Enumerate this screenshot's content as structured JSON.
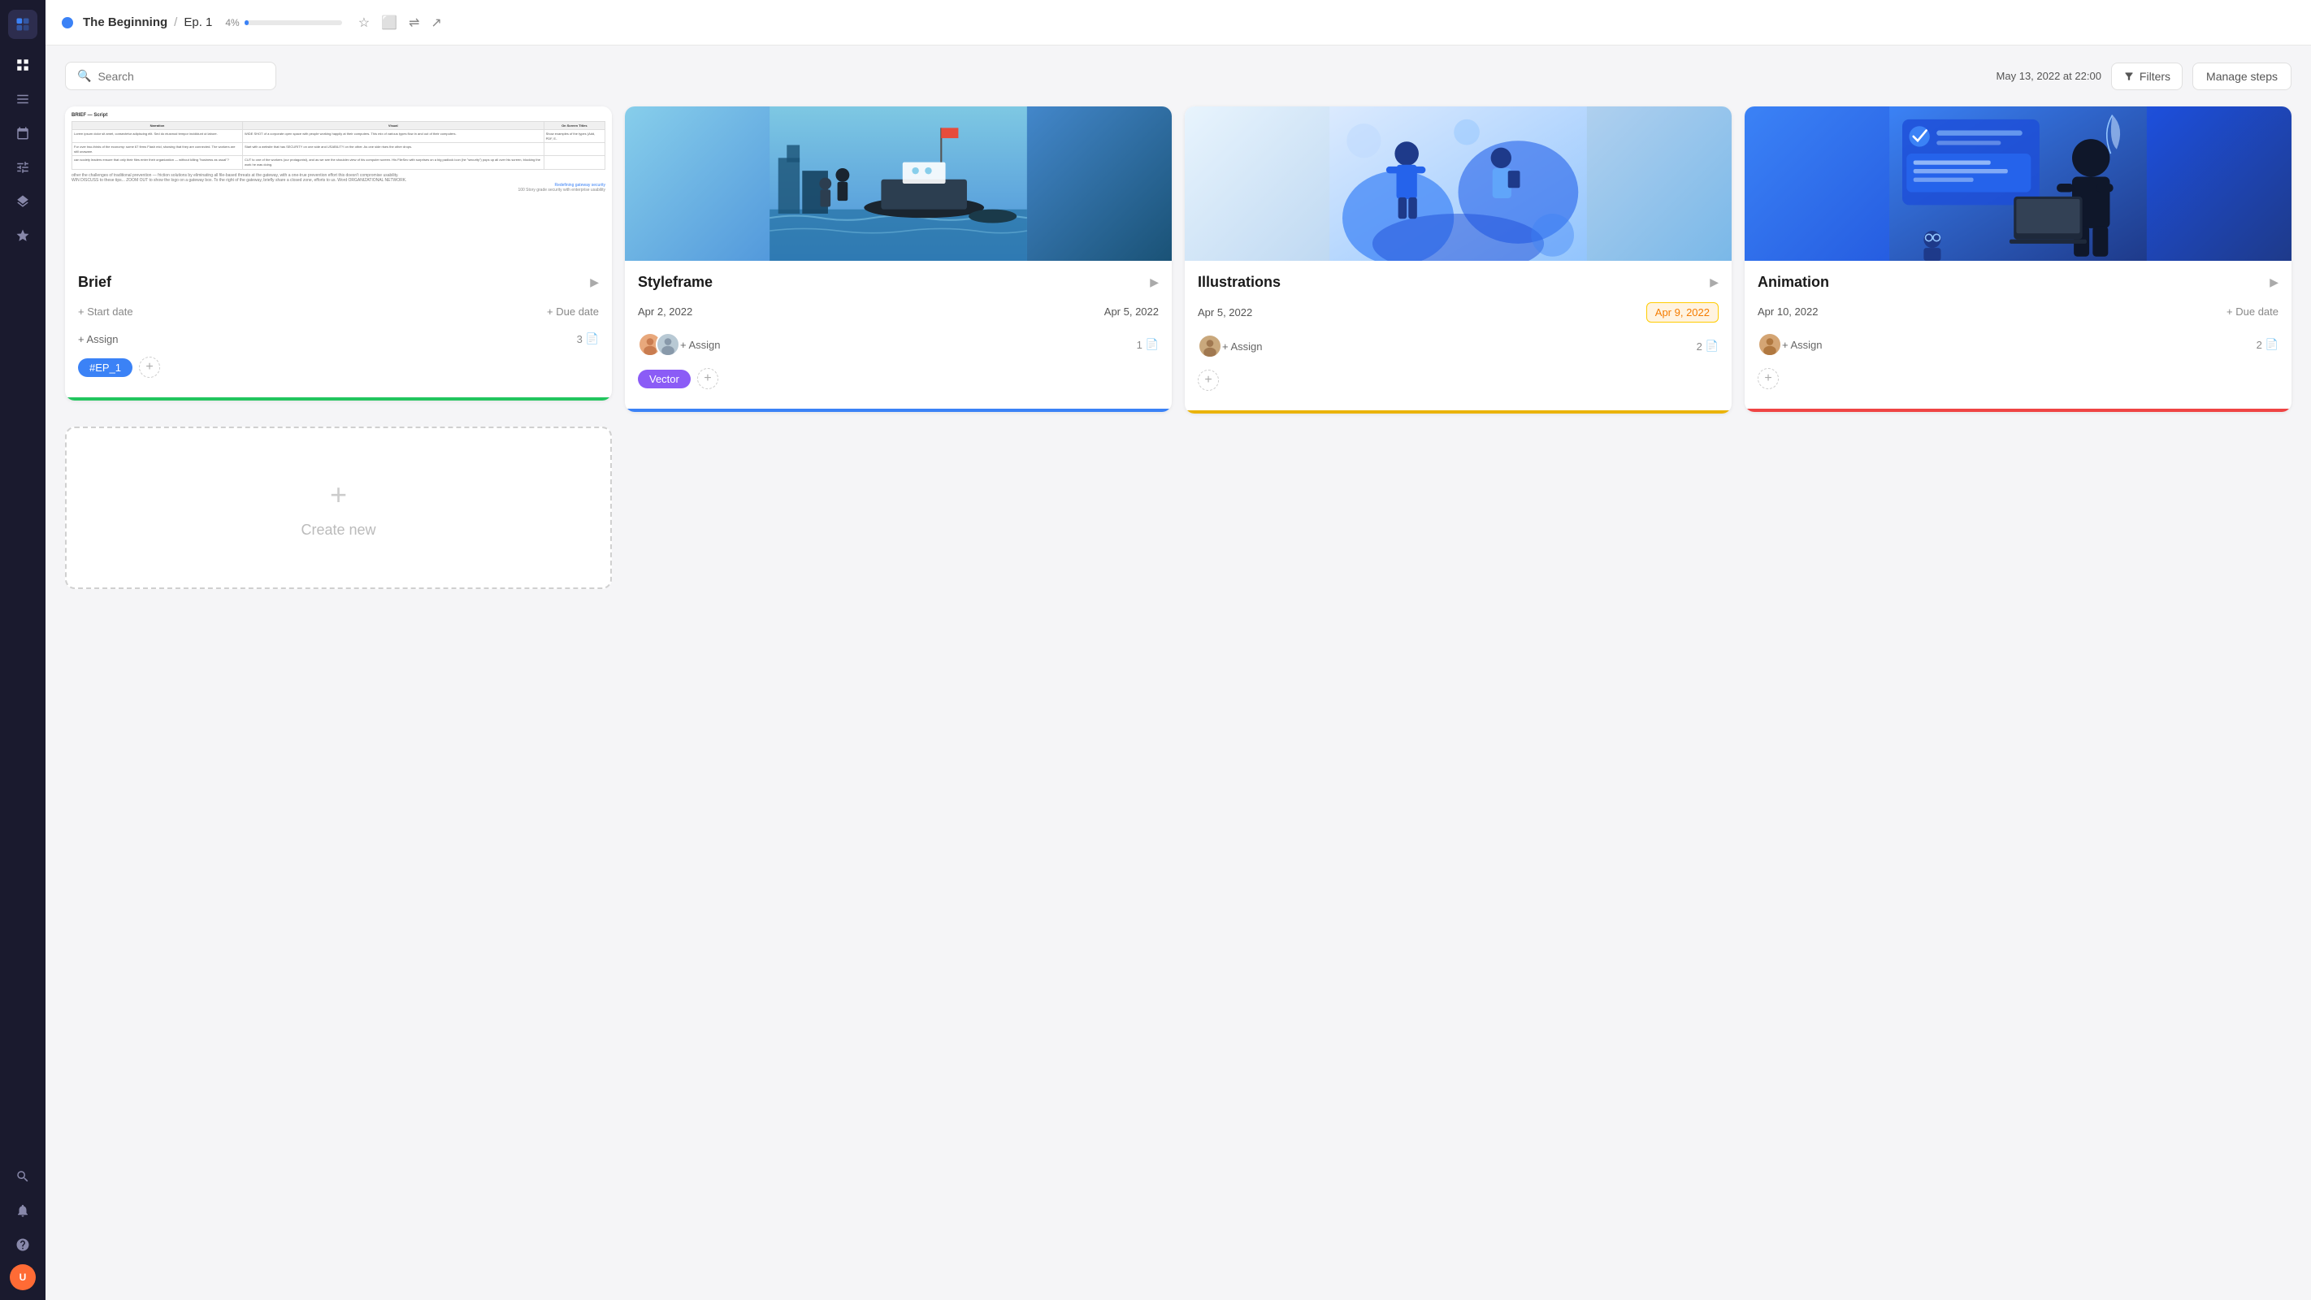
{
  "app": {
    "logo_label": "Logo",
    "sidebar_icons": [
      "grid",
      "list",
      "calendar",
      "sliders",
      "layers",
      "star",
      "search",
      "bell",
      "help"
    ],
    "user_initials": "U"
  },
  "topbar": {
    "dot_color": "#3b82f6",
    "project": "The Beginning",
    "separator": "/",
    "episode": "Ep. 1",
    "progress_percent": "4%",
    "actions": [
      "star",
      "screen",
      "sliders",
      "share"
    ]
  },
  "toolbar": {
    "search_placeholder": "Search",
    "date_label": "May 13, 2022 at 22:00",
    "filters_label": "Filters",
    "manage_steps_label": "Manage steps"
  },
  "cards": [
    {
      "id": "brief",
      "title": "Brief",
      "start_date": "+ Start date",
      "due_date": "+ Due date",
      "assign_label": "+ Assign",
      "count": "3",
      "tags": [
        "#EP_1"
      ],
      "tag_colors": [
        "blue"
      ],
      "bottom_bar": "green",
      "has_avatar": false,
      "avatar_initials": ""
    },
    {
      "id": "styleframe",
      "title": "Styleframe",
      "start_date": "Apr 2, 2022",
      "due_date": "Apr 5, 2022",
      "assign_label": "+ Assign",
      "count": "1",
      "tags": [
        "Vector"
      ],
      "tag_colors": [
        "purple"
      ],
      "bottom_bar": "blue",
      "has_avatar": true,
      "avatar_count": 2
    },
    {
      "id": "illustrations",
      "title": "Illustrations",
      "start_date": "Apr 5, 2022",
      "due_date": "Apr 9, 2022",
      "due_date_overdue": true,
      "assign_label": "+ Assign",
      "count": "2",
      "tags": [],
      "bottom_bar": "yellow",
      "has_avatar": true,
      "avatar_count": 1
    },
    {
      "id": "animation",
      "title": "Animation",
      "start_date": "Apr 10, 2022",
      "due_date": "+ Due date",
      "assign_label": "+ Assign",
      "count": "2",
      "tags": [],
      "bottom_bar": "red",
      "has_avatar": true,
      "avatar_count": 1
    }
  ],
  "create_new": {
    "plus": "+",
    "label": "Create new"
  }
}
